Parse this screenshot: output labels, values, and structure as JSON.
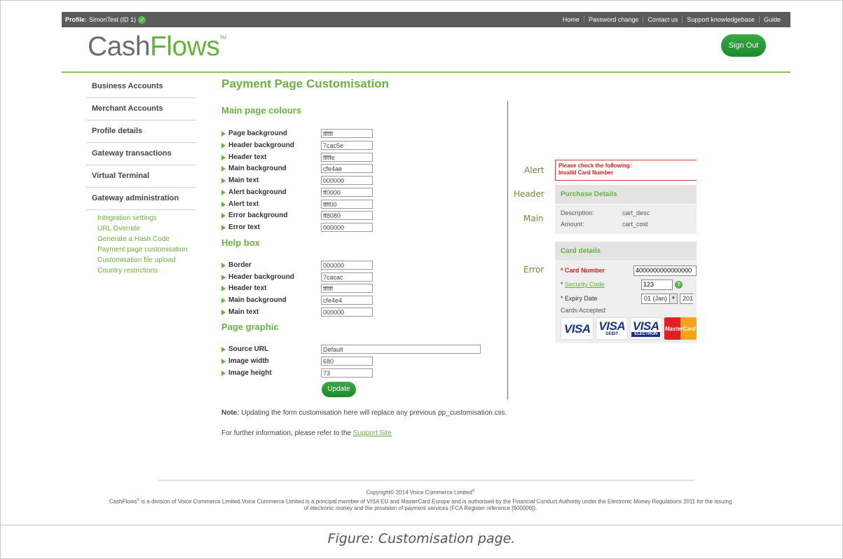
{
  "topbar": {
    "profile_label": "Profile:",
    "profile_value": "SimonTest (ID 1)",
    "links": [
      "Home",
      "Password change",
      "Contact us",
      "Support knowledgebase",
      "Guide"
    ]
  },
  "brand": {
    "logo_part1": "Cash",
    "logo_part2": "Flows",
    "logo_tm": "TM"
  },
  "signout_label": "Sign Out",
  "nav": {
    "items": [
      "Business Accounts",
      "Merchant Accounts",
      "Profile details",
      "Gateway transactions",
      "Virtual Terminal",
      "Gateway administration"
    ],
    "subitems": [
      "Integration settings",
      "URL Override",
      "Generate a Hash Code",
      "Payment page customisation",
      "Customisation file upload",
      "Country restrictions"
    ]
  },
  "page": {
    "title": "Payment Page Customisation",
    "sections": {
      "main_colours": "Main page colours",
      "help_box": "Help box",
      "page_graphic": "Page graphic"
    },
    "main_fields": [
      {
        "label": "Page background",
        "value": "ffffff"
      },
      {
        "label": "Header background",
        "value": "7cac5e"
      },
      {
        "label": "Header text",
        "value": "fffffe"
      },
      {
        "label": "Main background",
        "value": "cfe4ae"
      },
      {
        "label": "Main text",
        "value": "000000"
      },
      {
        "label": "Alert background",
        "value": "ff0000"
      },
      {
        "label": "Alert text",
        "value": "ffff00"
      },
      {
        "label": "Error background",
        "value": "ff8080"
      },
      {
        "label": "Error text",
        "value": "000000"
      }
    ],
    "help_fields": [
      {
        "label": "Border",
        "value": "000000"
      },
      {
        "label": "Header background",
        "value": "7cacac"
      },
      {
        "label": "Header text",
        "value": "ffffff"
      },
      {
        "label": "Main background",
        "value": "cfe4e4"
      },
      {
        "label": "Main text",
        "value": "000000"
      }
    ],
    "graphic_fields": [
      {
        "label": "Source URL",
        "value": "Default"
      },
      {
        "label": "Image width",
        "value": "680"
      },
      {
        "label": "Image height",
        "value": "73"
      }
    ],
    "update_label": "Update",
    "note_bold": "Note:",
    "note_text": " Updating the form customisation here will replace any previous pp_customisation.css.",
    "further_text": "For further information, please refer to the ",
    "support_link": "Support Site"
  },
  "preview": {
    "labels": {
      "alert": "Alert",
      "header": "Header",
      "main": "Main",
      "error": "Error"
    },
    "alert_line1": "Please check the following:",
    "alert_line2": "Invalid Card Number",
    "purchase_header": "Purchase Details",
    "description_label": "Description:",
    "description_value": "cart_desc",
    "amount_label": "Amount:",
    "amount_value": "cart_cost",
    "card_header": "Card details",
    "card_number_label": "* Card Number",
    "card_number_value": "4000000000000000",
    "security_prefix": "* ",
    "security_label": "Security Code",
    "security_value": "123",
    "expiry_label": "* Expiry Date",
    "expiry_month": "01 (Jan)",
    "expiry_year": "201",
    "cards_accepted": "Cards Accepted:",
    "card_logos": {
      "visa": "VISA",
      "debit": "DEBIT",
      "electron": "ELECTRON",
      "mastercard": "MasterCard"
    }
  },
  "footer": {
    "copyright": "Copyright© 2014 Voice Commerce Limited",
    "reg_mark": "®",
    "line1_brand": "CashFlows",
    "line1_rest": " is a division of Voice Commerce Limited.Voice Commerce Limited is a principal member of VISA EU and MasterCard Europe and is authorised by the Financial Conduct Authority under the Electronic Money Regulations 2011 for the issuing",
    "line2": "of electronic money and the provision of payment services (FCA Register reference [900006])."
  },
  "caption": "Figure: Customisation page.",
  "colors": {
    "brand_green": "#6ab23f",
    "topbar": "#5b5b5b",
    "alert_red": "#d42020"
  }
}
